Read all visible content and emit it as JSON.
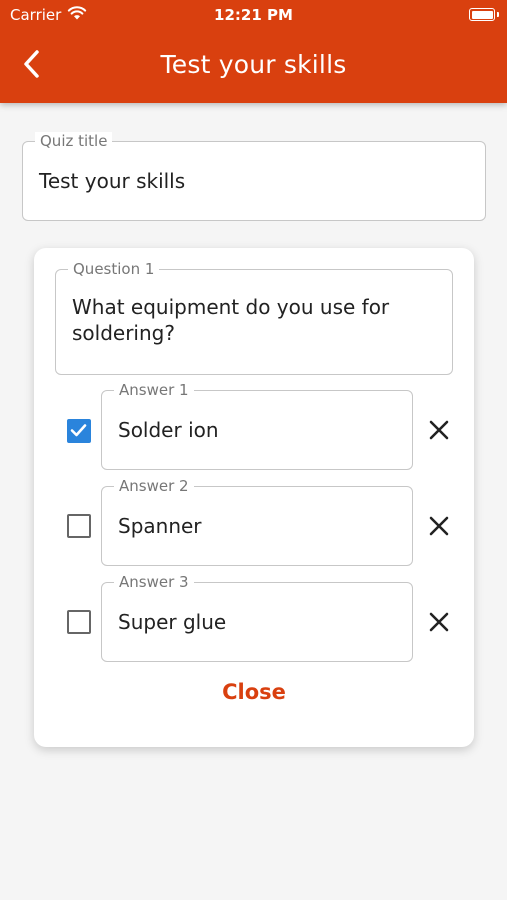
{
  "status_bar": {
    "carrier": "Carrier",
    "time": "12:21 PM",
    "wifi_icon": "wifi-icon",
    "battery_icon": "battery-icon"
  },
  "app_bar": {
    "back_icon": "chevron-left-icon",
    "title": "Test your skills",
    "color": "#d9400f"
  },
  "quiz_title": {
    "label": "Quiz title",
    "value": "Test your skills"
  },
  "question": {
    "label": "Question 1",
    "text": "What equipment do you use for soldering?",
    "answers": [
      {
        "label": "Answer 1",
        "value": "Solder ion",
        "correct": true
      },
      {
        "label": "Answer 2",
        "value": "Spanner",
        "correct": false
      },
      {
        "label": "Answer 3",
        "value": "Super glue",
        "correct": false
      }
    ],
    "close_label": "Close"
  },
  "colors": {
    "accent": "#d9400f",
    "checkbox_checked": "#2a84dc",
    "background": "#f5f5f5"
  }
}
